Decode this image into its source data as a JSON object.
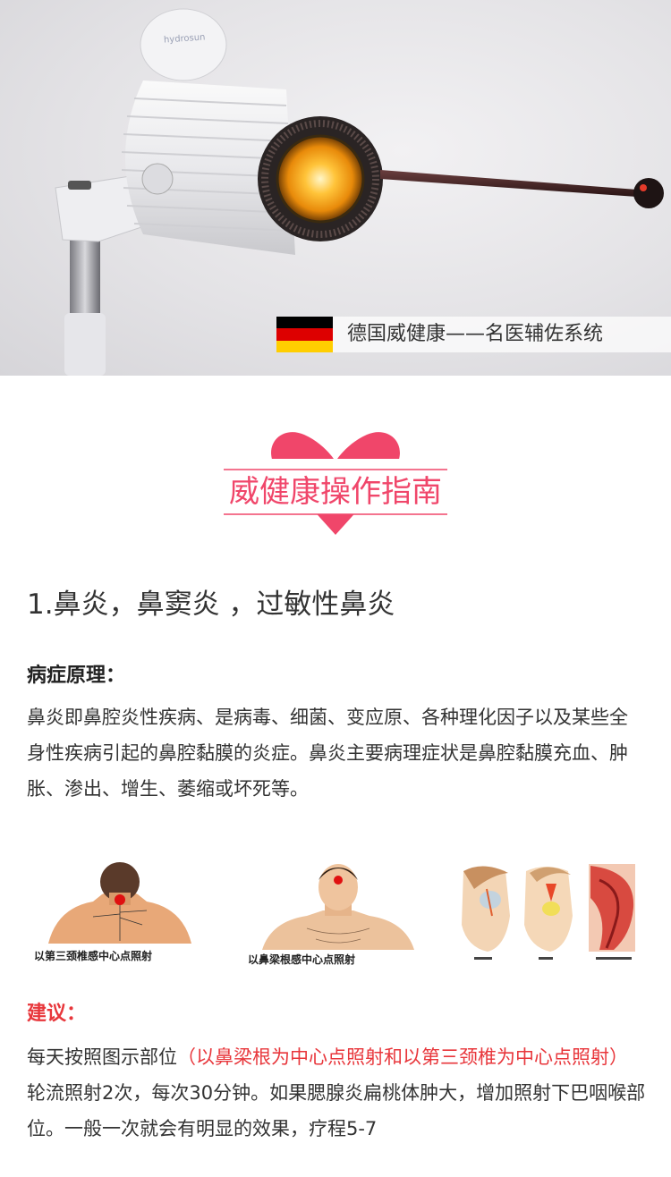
{
  "hero": {
    "brand": "hydrosun",
    "caption": "德国威健康——名医辅佐系统",
    "flag_colors": [
      "#000000",
      "#dd0000",
      "#ffce00"
    ]
  },
  "heading": {
    "title": "威健康操作指南",
    "accent": "#f0466a"
  },
  "section": {
    "title": "1.鼻炎，鼻窦炎 ，过敏性鼻炎",
    "principle_label": "病症原理：",
    "principle_text": "鼻炎即鼻腔炎性疾病、是病毒、细菌、变应原、各种理化因子以及某些全身性疾病引起的鼻腔黏膜的炎症。鼻炎主要病理症状是鼻腔黏膜充血、肿胀、渗出、增生、萎缩或坏死等。",
    "advice_label": "建议：",
    "advice_pre": "每天按照图示部位",
    "advice_highlight": "（以鼻梁根为中心点照射和以第三颈椎为中心点照射）",
    "advice_post": "轮流照射2次，每次30分钟。如果腮腺炎扁桃体肿大，增加照射下巴咽喉部位。一般一次就会有明显的效果，疗程5-7",
    "highlight_color": "#e8363b"
  },
  "figures": [
    {
      "caption": "以第三颈椎感中心点照射"
    },
    {
      "caption": "以鼻梁根感中心点照射"
    },
    {
      "caption": ""
    }
  ]
}
